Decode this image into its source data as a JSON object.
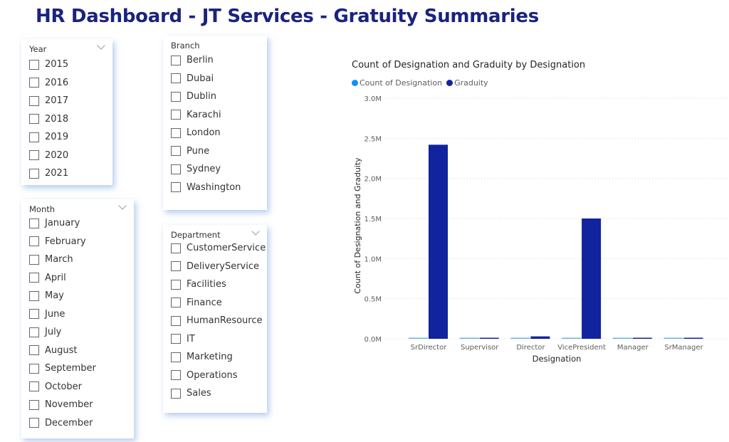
{
  "header": {
    "title": "HR Dashboard - JT Services - Gratuity Summaries"
  },
  "slicers": {
    "year": {
      "title": "Year",
      "items": [
        "2015",
        "2016",
        "2017",
        "2018",
        "2019",
        "2020",
        "2021"
      ]
    },
    "branch": {
      "title": "Branch",
      "items": [
        "Berlin",
        "Dubai",
        "Dublin",
        "Karachi",
        "London",
        "Pune",
        "Sydney",
        "Washington"
      ]
    },
    "month": {
      "title": "Month",
      "items": [
        "January",
        "February",
        "March",
        "April",
        "May",
        "June",
        "July",
        "August",
        "September",
        "October",
        "November",
        "December"
      ]
    },
    "department": {
      "title": "Department",
      "items": [
        "CustomerService",
        "DeliveryService",
        "Facilities",
        "Finance",
        "HumanResource",
        "IT",
        "Marketing",
        "Operations",
        "Sales"
      ]
    }
  },
  "colors": {
    "count": "#118dff",
    "gratuity": "#12239e",
    "title": "#1a237e"
  },
  "chart_data": {
    "type": "bar",
    "title": "Count of Designation and Graduity by Designation",
    "xlabel": "Designation",
    "ylabel": "Count of Designation and Graduity",
    "categories": [
      "SrDirector",
      "Supervisor",
      "Director",
      "VicePresident",
      "Manager",
      "SrManager"
    ],
    "series": [
      {
        "name": "Count of Designation",
        "values": [
          0.002,
          0.002,
          0.002,
          0.002,
          0.002,
          0.002
        ]
      },
      {
        "name": "Graduity",
        "values": [
          2.42,
          0,
          0.03,
          1.5,
          0,
          0
        ]
      }
    ],
    "units": "M",
    "ylim": [
      0,
      3.0
    ],
    "yticks": [
      "0.0M",
      "0.5M",
      "1.0M",
      "1.5M",
      "2.0M",
      "2.5M",
      "3.0M"
    ],
    "grid": true,
    "legend": "top-left"
  }
}
